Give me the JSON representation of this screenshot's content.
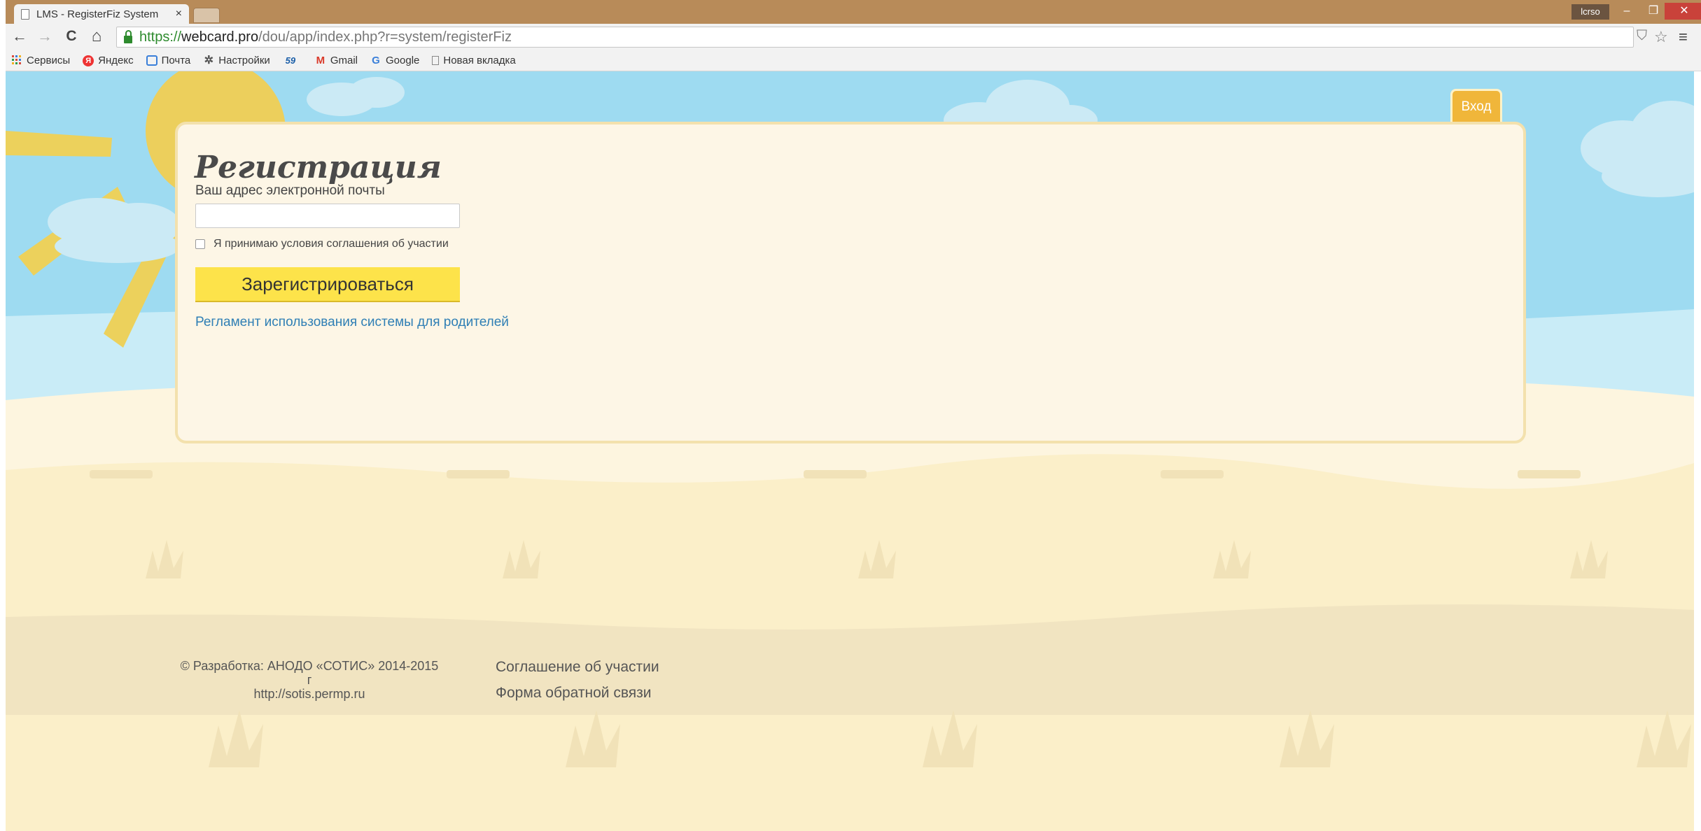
{
  "browser": {
    "tab_title": "LMS - RegisterFiz System",
    "tab_close": "×",
    "profile": "lcrso",
    "window_controls": {
      "minimize": "–",
      "restore": "❐",
      "close": "✕"
    },
    "nav": {
      "back": "←",
      "forward": "→",
      "reload": "C",
      "home": "⌂"
    },
    "url": {
      "scheme": "https://",
      "domain": "webcard.pro",
      "path": "/dou/app/index.php?r=system/registerFiz"
    },
    "toolbar_icons": {
      "shield": "⛉",
      "star": "☆",
      "menu": "≡"
    },
    "bookmarks": [
      {
        "label": "Сервисы",
        "icon": "apps-icon"
      },
      {
        "label": "Яндекс",
        "icon": "yandex-icon"
      },
      {
        "label": "Почта",
        "icon": "mail-icon"
      },
      {
        "label": "Настройки",
        "icon": "gear-icon"
      },
      {
        "label": "",
        "icon": "59",
        "icon_color": "#1a5ea8"
      },
      {
        "label": "Gmail",
        "icon": "gmail-icon"
      },
      {
        "label": "Google",
        "icon": "google-icon"
      },
      {
        "label": "Новая вкладка",
        "icon": "page-icon"
      }
    ]
  },
  "page": {
    "login_tab": "Вход",
    "title": "Регистрация",
    "email_label": "Ваш адрес электронной почты",
    "email_value": "",
    "agree_label": "Я принимаю условия соглашения об участии",
    "agree_checked": false,
    "register_button": "Зарегистрироваться",
    "rules_link": "Регламент использования системы для родителей"
  },
  "footer": {
    "copyright": "© Разработка: АНОДО «СОТИС» 2014-2015 г",
    "site": "http://sotis.permp.ru",
    "links": [
      "Соглашение об участии",
      "Форма обратной связи"
    ]
  },
  "colors": {
    "accent_yellow": "#fde34a",
    "login_tab": "#f0b63a",
    "link_blue": "#2f7fb5",
    "sky": "#9edbf1",
    "sand": "#fdf3d6"
  }
}
